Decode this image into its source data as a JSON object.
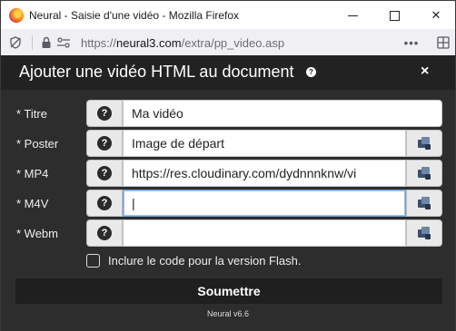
{
  "window": {
    "title": "Neural - Saisie d'une vidéo - Mozilla Firefox",
    "minimize_glyph": "",
    "close_glyph": "✕"
  },
  "address_bar": {
    "url_prefix": "https://",
    "url_domain": "neural3.com",
    "url_path": "/extra/pp_video.asp",
    "more_glyph": "•••",
    "extensions_glyph": "▣"
  },
  "dialog": {
    "title": "Ajouter une vidéo HTML au document",
    "close_glyph": "×",
    "help_glyph": "?",
    "fields": [
      {
        "label": "* Titre",
        "value": "Ma vidéo",
        "placeholder": ""
      },
      {
        "label": "* Poster",
        "value": "Image de départ",
        "placeholder": ""
      },
      {
        "label": "* MP4",
        "value": "https://res.cloudinary.com/dydnnnknw/vi",
        "placeholder": ""
      },
      {
        "label": "* M4V",
        "value": "|",
        "placeholder": ""
      },
      {
        "label": "* Webm",
        "value": "",
        "placeholder": ""
      }
    ],
    "flash_checkbox": {
      "label": "Inclure le code pour la version Flash.",
      "checked": false
    },
    "submit_label": "Soumettre",
    "footer": "Neural v6.6"
  },
  "icons": {
    "app": "firefox-icon",
    "tracking": "tracking-protection-icon",
    "lock": "lock-icon",
    "permissions": "permissions-icon",
    "help": "question-icon",
    "browse": "video-file-icon"
  },
  "colors": {
    "dialog_bg": "#2d2d2d",
    "header_bg": "#222222",
    "focus_border": "#6a9fe0"
  }
}
